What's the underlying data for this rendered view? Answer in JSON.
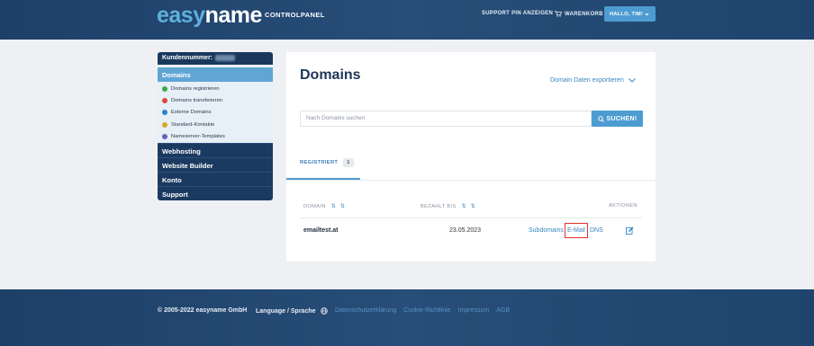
{
  "header": {
    "logo_easy": "easy",
    "logo_name": "name",
    "subtitle": "CONTROLPANEL",
    "support_pin": "SUPPORT PIN ANZEIGEN",
    "cart": "WARENKORB",
    "user": "HALLO, TIM!"
  },
  "sidebar": {
    "kunden_label": "Kundennummer:",
    "domains": "Domains",
    "sub": [
      {
        "label": "Domains registrieren",
        "icon": "plus-icon",
        "color": "#3aa84a"
      },
      {
        "label": "Domains transferieren",
        "icon": "transfer-icon",
        "color": "#d64a3a"
      },
      {
        "label": "Externe Domains",
        "icon": "globe-icon",
        "color": "#2f7fc4"
      },
      {
        "label": "Standard-Kontakte",
        "icon": "contact-icon",
        "color": "#d9a62a"
      },
      {
        "label": "Nameserver-Templates",
        "icon": "server-icon",
        "color": "#6f5fb8"
      }
    ],
    "webhosting": "Webhosting",
    "website_builder": "Website Builder",
    "konto": "Konto",
    "support": "Support"
  },
  "main": {
    "title": "Domains",
    "export": "Domain Daten exportieren",
    "search_placeholder": "Nach Domains suchen",
    "search_button": "SUCHEN!",
    "tab_label": "REGISTRIERT",
    "tab_count": "1",
    "col_domain": "DOMAIN",
    "col_paid": "BEZAHLT BIS",
    "col_actions": "AKTIONEN",
    "rows": [
      {
        "domain": "emailtest.at",
        "paid_until": "23.05.2023",
        "subdomains": "Subdomains",
        "email": "E-Mail",
        "dns": "DNS"
      }
    ]
  },
  "footer": {
    "copyright": "© 2005-2022 easyname GmbH",
    "language": "Language / Sprache",
    "links": [
      "Datenschutzerklärung",
      "Cookie-Richtlinie",
      "Impressum",
      "AGB"
    ]
  },
  "colors": {
    "accent": "#4d9cd1",
    "navy": "#1b3a60",
    "highlight": "#e0322b"
  }
}
